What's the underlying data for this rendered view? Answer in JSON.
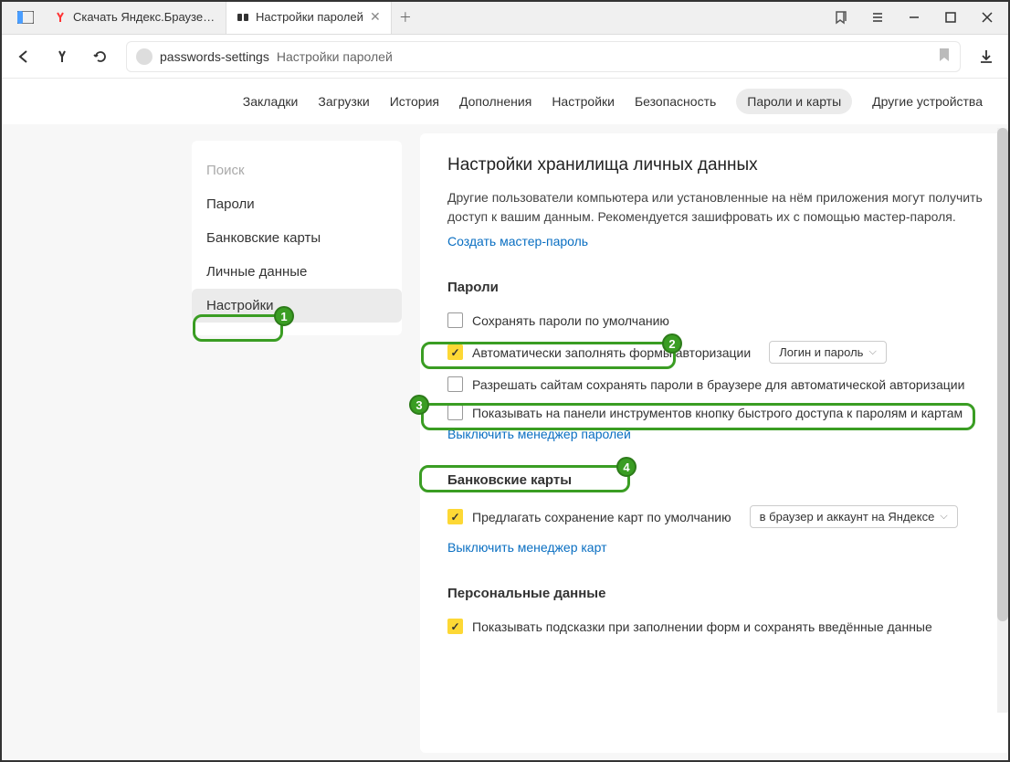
{
  "titlebar": {
    "tabs": [
      {
        "label": "Скачать Яндекс.Браузер д",
        "icon": "yandex"
      },
      {
        "label": "Настройки паролей",
        "icon": "settings"
      }
    ]
  },
  "addrbar": {
    "url1": "passwords-settings",
    "url2": "Настройки паролей"
  },
  "nav": {
    "items": [
      "Закладки",
      "Загрузки",
      "История",
      "Дополнения",
      "Настройки",
      "Безопасность",
      "Пароли и карты",
      "Другие устройства"
    ]
  },
  "sidebar": {
    "search_placeholder": "Поиск",
    "items": [
      "Пароли",
      "Банковские карты",
      "Личные данные",
      "Настройки"
    ]
  },
  "main": {
    "title": "Настройки хранилища личных данных",
    "desc": "Другие пользователи компьютера или установленные на нём приложения могут получить доступ к вашим данным. Рекомендуется зашифровать их с помощью мастер-пароля.",
    "create_master": "Создать мастер-пароль",
    "passwords_section": "Пароли",
    "opts": {
      "save_default": "Сохранять пароли по умолчанию",
      "autofill": "Автоматически заполнять формы авторизации",
      "autofill_mode": "Логин и пароль",
      "allow_sites": "Разрешать сайтам сохранять пароли в браузере для автоматической авторизации",
      "show_toolbar": "Показывать на панели инструментов кнопку быстрого доступа к паролям и картам"
    },
    "disable_pwd_mgr": "Выключить менеджер паролей",
    "cards_section": "Банковские карты",
    "cards_save": "Предлагать сохранение карт по умолчанию",
    "cards_mode": "в браузер и аккаунт на Яндексе",
    "disable_cards": "Выключить менеджер карт",
    "personal_section": "Персональные данные",
    "personal_hints": "Показывать подсказки при заполнении форм и сохранять введённые данные"
  },
  "annotations": {
    "b1": "1",
    "b2": "2",
    "b3": "3",
    "b4": "4"
  }
}
